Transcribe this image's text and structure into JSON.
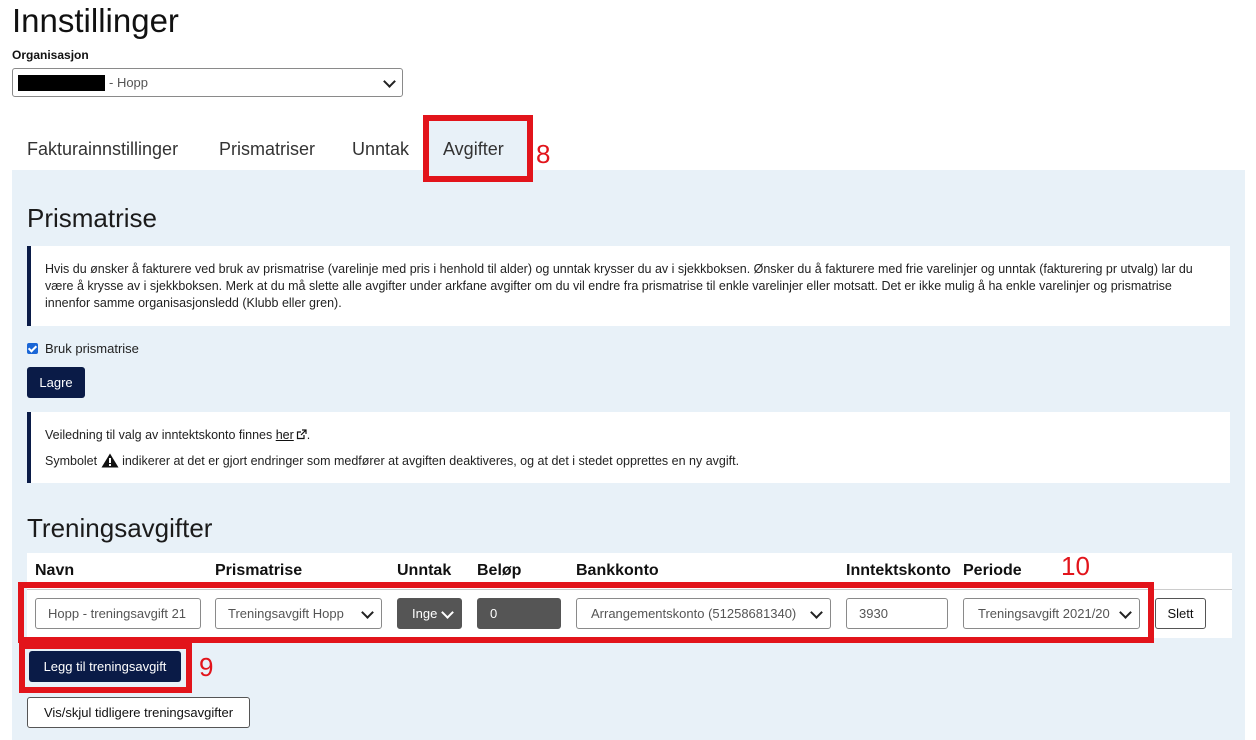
{
  "page": {
    "title": "Innstillinger"
  },
  "organization": {
    "label": "Organisasjon",
    "selected": "- Hopp"
  },
  "tabs": [
    {
      "label": "Fakturainnstillinger"
    },
    {
      "label": "Prismatriser"
    },
    {
      "label": "Unntak"
    },
    {
      "label": "Avgifter"
    }
  ],
  "annotations": {
    "tab_marker": "8",
    "add_marker": "9",
    "row_marker": "10"
  },
  "prismatrise": {
    "heading": "Prismatrise",
    "info": "Hvis du ønsker å fakturere ved bruk av prismatrise (varelinje med pris i henhold til alder) og unntak krysser du av i sjekkboksen. Ønsker du å fakturere med frie varelinjer og unntak (fakturering pr utvalg) lar du være å krysse av i sjekkboksen. Merk at du må slette alle avgifter under arkfane avgifter om du vil endre fra prismatrise til enkle varelinjer eller motsatt. Det er ikke mulig å ha enkle varelinjer og prismatrise innenfor samme organisasjonsledd (Klubb eller gren).",
    "checkbox_label": "Bruk prismatrise",
    "checked": true,
    "save_label": "Lagre"
  },
  "guide": {
    "line1_prefix": "Veiledning til valg av inntektskonto finnes ",
    "line1_link": "her",
    "line1_suffix": ".",
    "line2_prefix": "Symbolet ",
    "line2_suffix": " indikerer at det er gjort endringer som medfører at avgiften deaktiveres, og at det i stedet opprettes en ny avgift."
  },
  "treningsavgifter": {
    "heading": "Treningsavgifter",
    "columns": [
      "Navn",
      "Prismatrise",
      "Unntak",
      "Beløp",
      "Bankkonto",
      "Inntektskonto",
      "Periode"
    ],
    "row": {
      "navn": "Hopp - treningsavgift 21",
      "prismatrise": "Treningsavgift Hopp",
      "unntak": "Inge",
      "belop": "0",
      "bankkonto": "Arrangementskonto (51258681340)",
      "inntektskonto": "3930",
      "periode": "Treningsavgift 2021/20",
      "delete_label": "Slett"
    },
    "add_label": "Legg til treningsavgift",
    "toggle_label": "Vis/skjul tidligere treningsavgifter"
  },
  "colors": {
    "accent": "#0a1b47",
    "annotation": "#e2141b",
    "panel": "#e8f1f8"
  }
}
